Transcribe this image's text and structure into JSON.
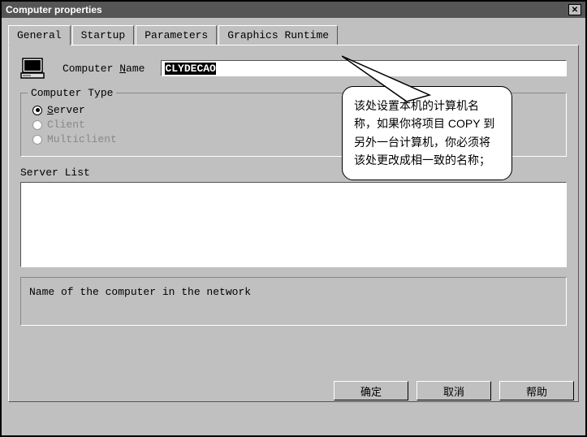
{
  "window": {
    "title": "Computer properties"
  },
  "tabs": [
    {
      "label": "General",
      "active": true
    },
    {
      "label": "Startup",
      "active": false
    },
    {
      "label": "Parameters",
      "active": false
    },
    {
      "label": "Graphics Runtime",
      "active": false
    }
  ],
  "computer_name": {
    "label": "Computer Name",
    "value": "CLYDECAO"
  },
  "computer_type": {
    "legend": "Computer Type",
    "options": [
      {
        "label": "Server",
        "checked": true,
        "enabled": true
      },
      {
        "label": "Client",
        "checked": false,
        "enabled": false
      },
      {
        "label": "Multiclient",
        "checked": false,
        "enabled": false
      }
    ]
  },
  "server_list": {
    "title": "Server List"
  },
  "description": {
    "text": "Name of the computer in the network"
  },
  "buttons": {
    "ok": "确定",
    "cancel": "取消",
    "help": "帮助"
  },
  "callout": {
    "text": "该处设置本机的计算机名称，如果你将项目 COPY 到另外一台计算机，你必须将该处更改成相一致的名称；"
  }
}
